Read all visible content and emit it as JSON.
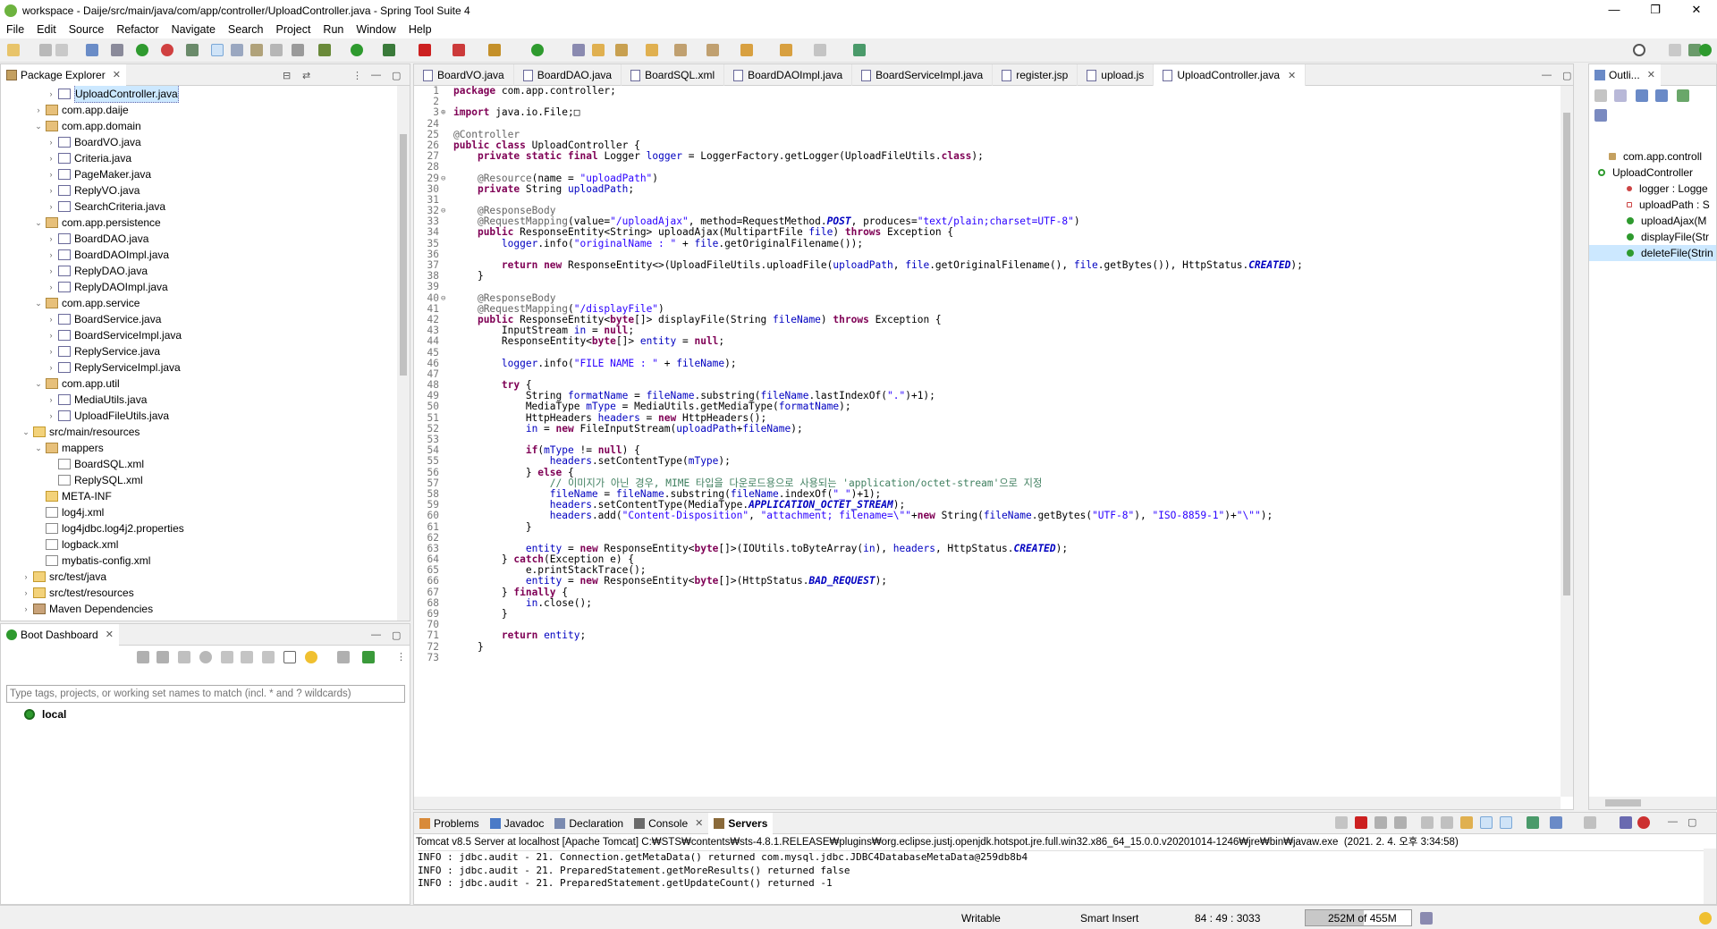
{
  "window": {
    "title": "workspace - Daije/src/main/java/com/app/controller/UploadController.java - Spring Tool Suite 4",
    "buttons": [
      "—",
      "❐",
      "✕"
    ]
  },
  "menu": [
    "File",
    "Edit",
    "Source",
    "Refactor",
    "Navigate",
    "Search",
    "Project",
    "Run",
    "Window",
    "Help"
  ],
  "package_explorer": {
    "tab_label": "Package Explorer",
    "rows": [
      {
        "text": "UploadController.java",
        "indent": 4,
        "type": "java",
        "twisty": "›",
        "selected": true
      },
      {
        "text": "com.app.daije",
        "indent": 3,
        "type": "pkg",
        "twisty": "›"
      },
      {
        "text": "com.app.domain",
        "indent": 3,
        "type": "pkg",
        "twisty": "⌄"
      },
      {
        "text": "BoardVO.java",
        "indent": 4,
        "type": "java",
        "twisty": "›"
      },
      {
        "text": "Criteria.java",
        "indent": 4,
        "type": "java",
        "twisty": "›"
      },
      {
        "text": "PageMaker.java",
        "indent": 4,
        "type": "java",
        "twisty": "›"
      },
      {
        "text": "ReplyVO.java",
        "indent": 4,
        "type": "java",
        "twisty": "›"
      },
      {
        "text": "SearchCriteria.java",
        "indent": 4,
        "type": "java",
        "twisty": "›"
      },
      {
        "text": "com.app.persistence",
        "indent": 3,
        "type": "pkg",
        "twisty": "⌄"
      },
      {
        "text": "BoardDAO.java",
        "indent": 4,
        "type": "java",
        "twisty": "›"
      },
      {
        "text": "BoardDAOImpl.java",
        "indent": 4,
        "type": "java",
        "twisty": "›"
      },
      {
        "text": "ReplyDAO.java",
        "indent": 4,
        "type": "java",
        "twisty": "›"
      },
      {
        "text": "ReplyDAOImpl.java",
        "indent": 4,
        "type": "java",
        "twisty": "›"
      },
      {
        "text": "com.app.service",
        "indent": 3,
        "type": "pkg",
        "twisty": "⌄"
      },
      {
        "text": "BoardService.java",
        "indent": 4,
        "type": "java",
        "twisty": "›"
      },
      {
        "text": "BoardServiceImpl.java",
        "indent": 4,
        "type": "java",
        "twisty": "›"
      },
      {
        "text": "ReplyService.java",
        "indent": 4,
        "type": "java",
        "twisty": "›"
      },
      {
        "text": "ReplyServiceImpl.java",
        "indent": 4,
        "type": "java",
        "twisty": "›"
      },
      {
        "text": "com.app.util",
        "indent": 3,
        "type": "pkg",
        "twisty": "⌄"
      },
      {
        "text": "MediaUtils.java",
        "indent": 4,
        "type": "java",
        "twisty": "›"
      },
      {
        "text": "UploadFileUtils.java",
        "indent": 4,
        "type": "java",
        "twisty": "›"
      },
      {
        "text": "src/main/resources",
        "indent": 2,
        "type": "folder",
        "twisty": "⌄"
      },
      {
        "text": "mappers",
        "indent": 3,
        "type": "pkg",
        "twisty": "⌄"
      },
      {
        "text": "BoardSQL.xml",
        "indent": 4,
        "type": "xml",
        "twisty": ""
      },
      {
        "text": "ReplySQL.xml",
        "indent": 4,
        "type": "xml",
        "twisty": ""
      },
      {
        "text": "META-INF",
        "indent": 3,
        "type": "folder",
        "twisty": ""
      },
      {
        "text": "log4j.xml",
        "indent": 3,
        "type": "xml",
        "twisty": ""
      },
      {
        "text": "log4jdbc.log4j2.properties",
        "indent": 3,
        "type": "xml",
        "twisty": ""
      },
      {
        "text": "logback.xml",
        "indent": 3,
        "type": "xml",
        "twisty": ""
      },
      {
        "text": "mybatis-config.xml",
        "indent": 3,
        "type": "xml",
        "twisty": ""
      },
      {
        "text": "src/test/java",
        "indent": 2,
        "type": "folder",
        "twisty": "›"
      },
      {
        "text": "src/test/resources",
        "indent": 2,
        "type": "folder",
        "twisty": "›"
      },
      {
        "text": "Maven Dependencies",
        "indent": 2,
        "type": "lib",
        "twisty": "›"
      }
    ]
  },
  "boot_dashboard": {
    "tab_label": "Boot Dashboard",
    "filter_placeholder": "Type tags, projects, or working set names to match (incl. * and ? wildcards)",
    "local_label": "local"
  },
  "editor": {
    "tabs": [
      "BoardVO.java",
      "BoardDAO.java",
      "BoardSQL.xml",
      "BoardDAOImpl.java",
      "BoardServiceImpl.java",
      "register.jsp",
      "upload.js",
      "UploadController.java"
    ],
    "active_tab": "UploadController.java",
    "lines": [
      {
        "n": "1",
        "f": "",
        "t": "package com.app.controller;"
      },
      {
        "n": "2",
        "f": "",
        "t": ""
      },
      {
        "n": "3",
        "f": "⊕",
        "t": "import java.io.File;□"
      },
      {
        "n": "24",
        "f": "",
        "t": ""
      },
      {
        "n": "25",
        "f": "",
        "t": "@Controller"
      },
      {
        "n": "26",
        "f": "",
        "t": "public class UploadController {"
      },
      {
        "n": "27",
        "f": "",
        "t": "    private static final Logger logger = LoggerFactory.getLogger(UploadFileUtils.class);"
      },
      {
        "n": "28",
        "f": "",
        "t": ""
      },
      {
        "n": "29",
        "f": "⊖",
        "t": "    @Resource(name = \"uploadPath\")"
      },
      {
        "n": "30",
        "f": "",
        "t": "    private String uploadPath;"
      },
      {
        "n": "31",
        "f": "",
        "t": ""
      },
      {
        "n": "32",
        "f": "⊖",
        "t": "    @ResponseBody"
      },
      {
        "n": "33",
        "f": "",
        "t": "    @RequestMapping(value=\"/uploadAjax\", method=RequestMethod.POST, produces=\"text/plain;charset=UTF-8\")"
      },
      {
        "n": "34",
        "f": "",
        "t": "    public ResponseEntity<String> uploadAjax(MultipartFile file) throws Exception {"
      },
      {
        "n": "35",
        "f": "",
        "t": "        logger.info(\"originalName : \" + file.getOriginalFilename());"
      },
      {
        "n": "36",
        "f": "",
        "t": ""
      },
      {
        "n": "37",
        "f": "",
        "t": "        return new ResponseEntity<>(UploadFileUtils.uploadFile(uploadPath, file.getOriginalFilename(), file.getBytes()), HttpStatus.CREATED);"
      },
      {
        "n": "38",
        "f": "",
        "t": "    }"
      },
      {
        "n": "39",
        "f": "",
        "t": ""
      },
      {
        "n": "40",
        "f": "⊖",
        "t": "    @ResponseBody"
      },
      {
        "n": "41",
        "f": "",
        "t": "    @RequestMapping(\"/displayFile\")"
      },
      {
        "n": "42",
        "f": "",
        "t": "    public ResponseEntity<byte[]> displayFile(String fileName) throws Exception {"
      },
      {
        "n": "43",
        "f": "",
        "t": "        InputStream in = null;"
      },
      {
        "n": "44",
        "f": "",
        "t": "        ResponseEntity<byte[]> entity = null;"
      },
      {
        "n": "45",
        "f": "",
        "t": ""
      },
      {
        "n": "46",
        "f": "",
        "t": "        logger.info(\"FILE NAME : \" + fileName);"
      },
      {
        "n": "47",
        "f": "",
        "t": ""
      },
      {
        "n": "48",
        "f": "",
        "t": "        try {"
      },
      {
        "n": "49",
        "f": "",
        "t": "            String formatName = fileName.substring(fileName.lastIndexOf(\".\")+1);"
      },
      {
        "n": "50",
        "f": "",
        "t": "            MediaType mType = MediaUtils.getMediaType(formatName);"
      },
      {
        "n": "51",
        "f": "",
        "t": "            HttpHeaders headers = new HttpHeaders();"
      },
      {
        "n": "52",
        "f": "",
        "t": "            in = new FileInputStream(uploadPath+fileName);"
      },
      {
        "n": "53",
        "f": "",
        "t": ""
      },
      {
        "n": "54",
        "f": "",
        "t": "            if(mType != null) {"
      },
      {
        "n": "55",
        "f": "",
        "t": "                headers.setContentType(mType);"
      },
      {
        "n": "56",
        "f": "",
        "t": "            } else {"
      },
      {
        "n": "57",
        "f": "",
        "t": "                // 이미지가 아닌 경우, MIME 타입을 다운로드용으로 사용되는 'application/octet-stream'으로 지정"
      },
      {
        "n": "58",
        "f": "",
        "t": "                fileName = fileName.substring(fileName.indexOf(\"_\")+1);"
      },
      {
        "n": "59",
        "f": "",
        "t": "                headers.setContentType(MediaType.APPLICATION_OCTET_STREAM);"
      },
      {
        "n": "60",
        "f": "",
        "t": "                headers.add(\"Content-Disposition\", \"attachment; filename=\\\"\"+new String(fileName.getBytes(\"UTF-8\"), \"ISO-8859-1\")+\"\\\"\");"
      },
      {
        "n": "61",
        "f": "",
        "t": "            }"
      },
      {
        "n": "62",
        "f": "",
        "t": ""
      },
      {
        "n": "63",
        "f": "",
        "t": "            entity = new ResponseEntity<byte[]>(IOUtils.toByteArray(in), headers, HttpStatus.CREATED);"
      },
      {
        "n": "64",
        "f": "",
        "t": "        } catch(Exception e) {"
      },
      {
        "n": "65",
        "f": "",
        "t": "            e.printStackTrace();"
      },
      {
        "n": "66",
        "f": "",
        "t": "            entity = new ResponseEntity<byte[]>(HttpStatus.BAD_REQUEST);"
      },
      {
        "n": "67",
        "f": "",
        "t": "        } finally {"
      },
      {
        "n": "68",
        "f": "",
        "t": "            in.close();"
      },
      {
        "n": "69",
        "f": "",
        "t": "        }"
      },
      {
        "n": "70",
        "f": "",
        "t": ""
      },
      {
        "n": "71",
        "f": "",
        "t": "        return entity;"
      },
      {
        "n": "72",
        "f": "",
        "t": "    }"
      },
      {
        "n": "73",
        "f": "",
        "t": ""
      }
    ]
  },
  "outline": {
    "tab_label": "Outli...",
    "rows": [
      {
        "text": "com.app.controll",
        "kind": "import"
      },
      {
        "text": "UploadController",
        "kind": "class"
      },
      {
        "text": "logger : Logge",
        "kind": "field-static"
      },
      {
        "text": "uploadPath : S",
        "kind": "field-private"
      },
      {
        "text": "uploadAjax(M",
        "kind": "method"
      },
      {
        "text": "displayFile(Str",
        "kind": "method"
      },
      {
        "text": "deleteFile(Strin",
        "kind": "method",
        "selected": true
      }
    ]
  },
  "bottom": {
    "tabs": [
      {
        "label": "Problems",
        "active": false
      },
      {
        "label": "Javadoc",
        "active": false
      },
      {
        "label": "Declaration",
        "active": false
      },
      {
        "label": "Console",
        "active": false
      },
      {
        "label": "Servers",
        "active": true
      }
    ],
    "console_header": "Tomcat v8.5 Server at localhost [Apache Tomcat] C:₩STS₩contents₩sts-4.8.1.RELEASE₩plugins₩org.eclipse.justj.openjdk.hotspot.jre.full.win32.x86_64_15.0.0.v20201014-1246₩jre₩bin₩javaw.exe  (2021. 2. 4. 오후 3:34:58)",
    "console_lines": [
      "INFO : jdbc.audit - 21. Connection.getMetaData() returned com.mysql.jdbc.JDBC4DatabaseMetaData@259db8b4",
      "INFO : jdbc.audit - 21. PreparedStatement.getMoreResults() returned false",
      "INFO : jdbc.audit - 21. PreparedStatement.getUpdateCount() returned -1"
    ]
  },
  "status": {
    "writable": "Writable",
    "insert_mode": "Smart Insert",
    "position": "84 : 49 : 3033",
    "heap_label": "252M of 455M",
    "heap_used_fraction": 0.554
  },
  "colors": {
    "keyword": "#7f0055",
    "string": "#2a00ff",
    "comment": "#3f7f5f",
    "annotation": "#646464",
    "field": "#0000c0",
    "selection": "#cce8ff"
  }
}
